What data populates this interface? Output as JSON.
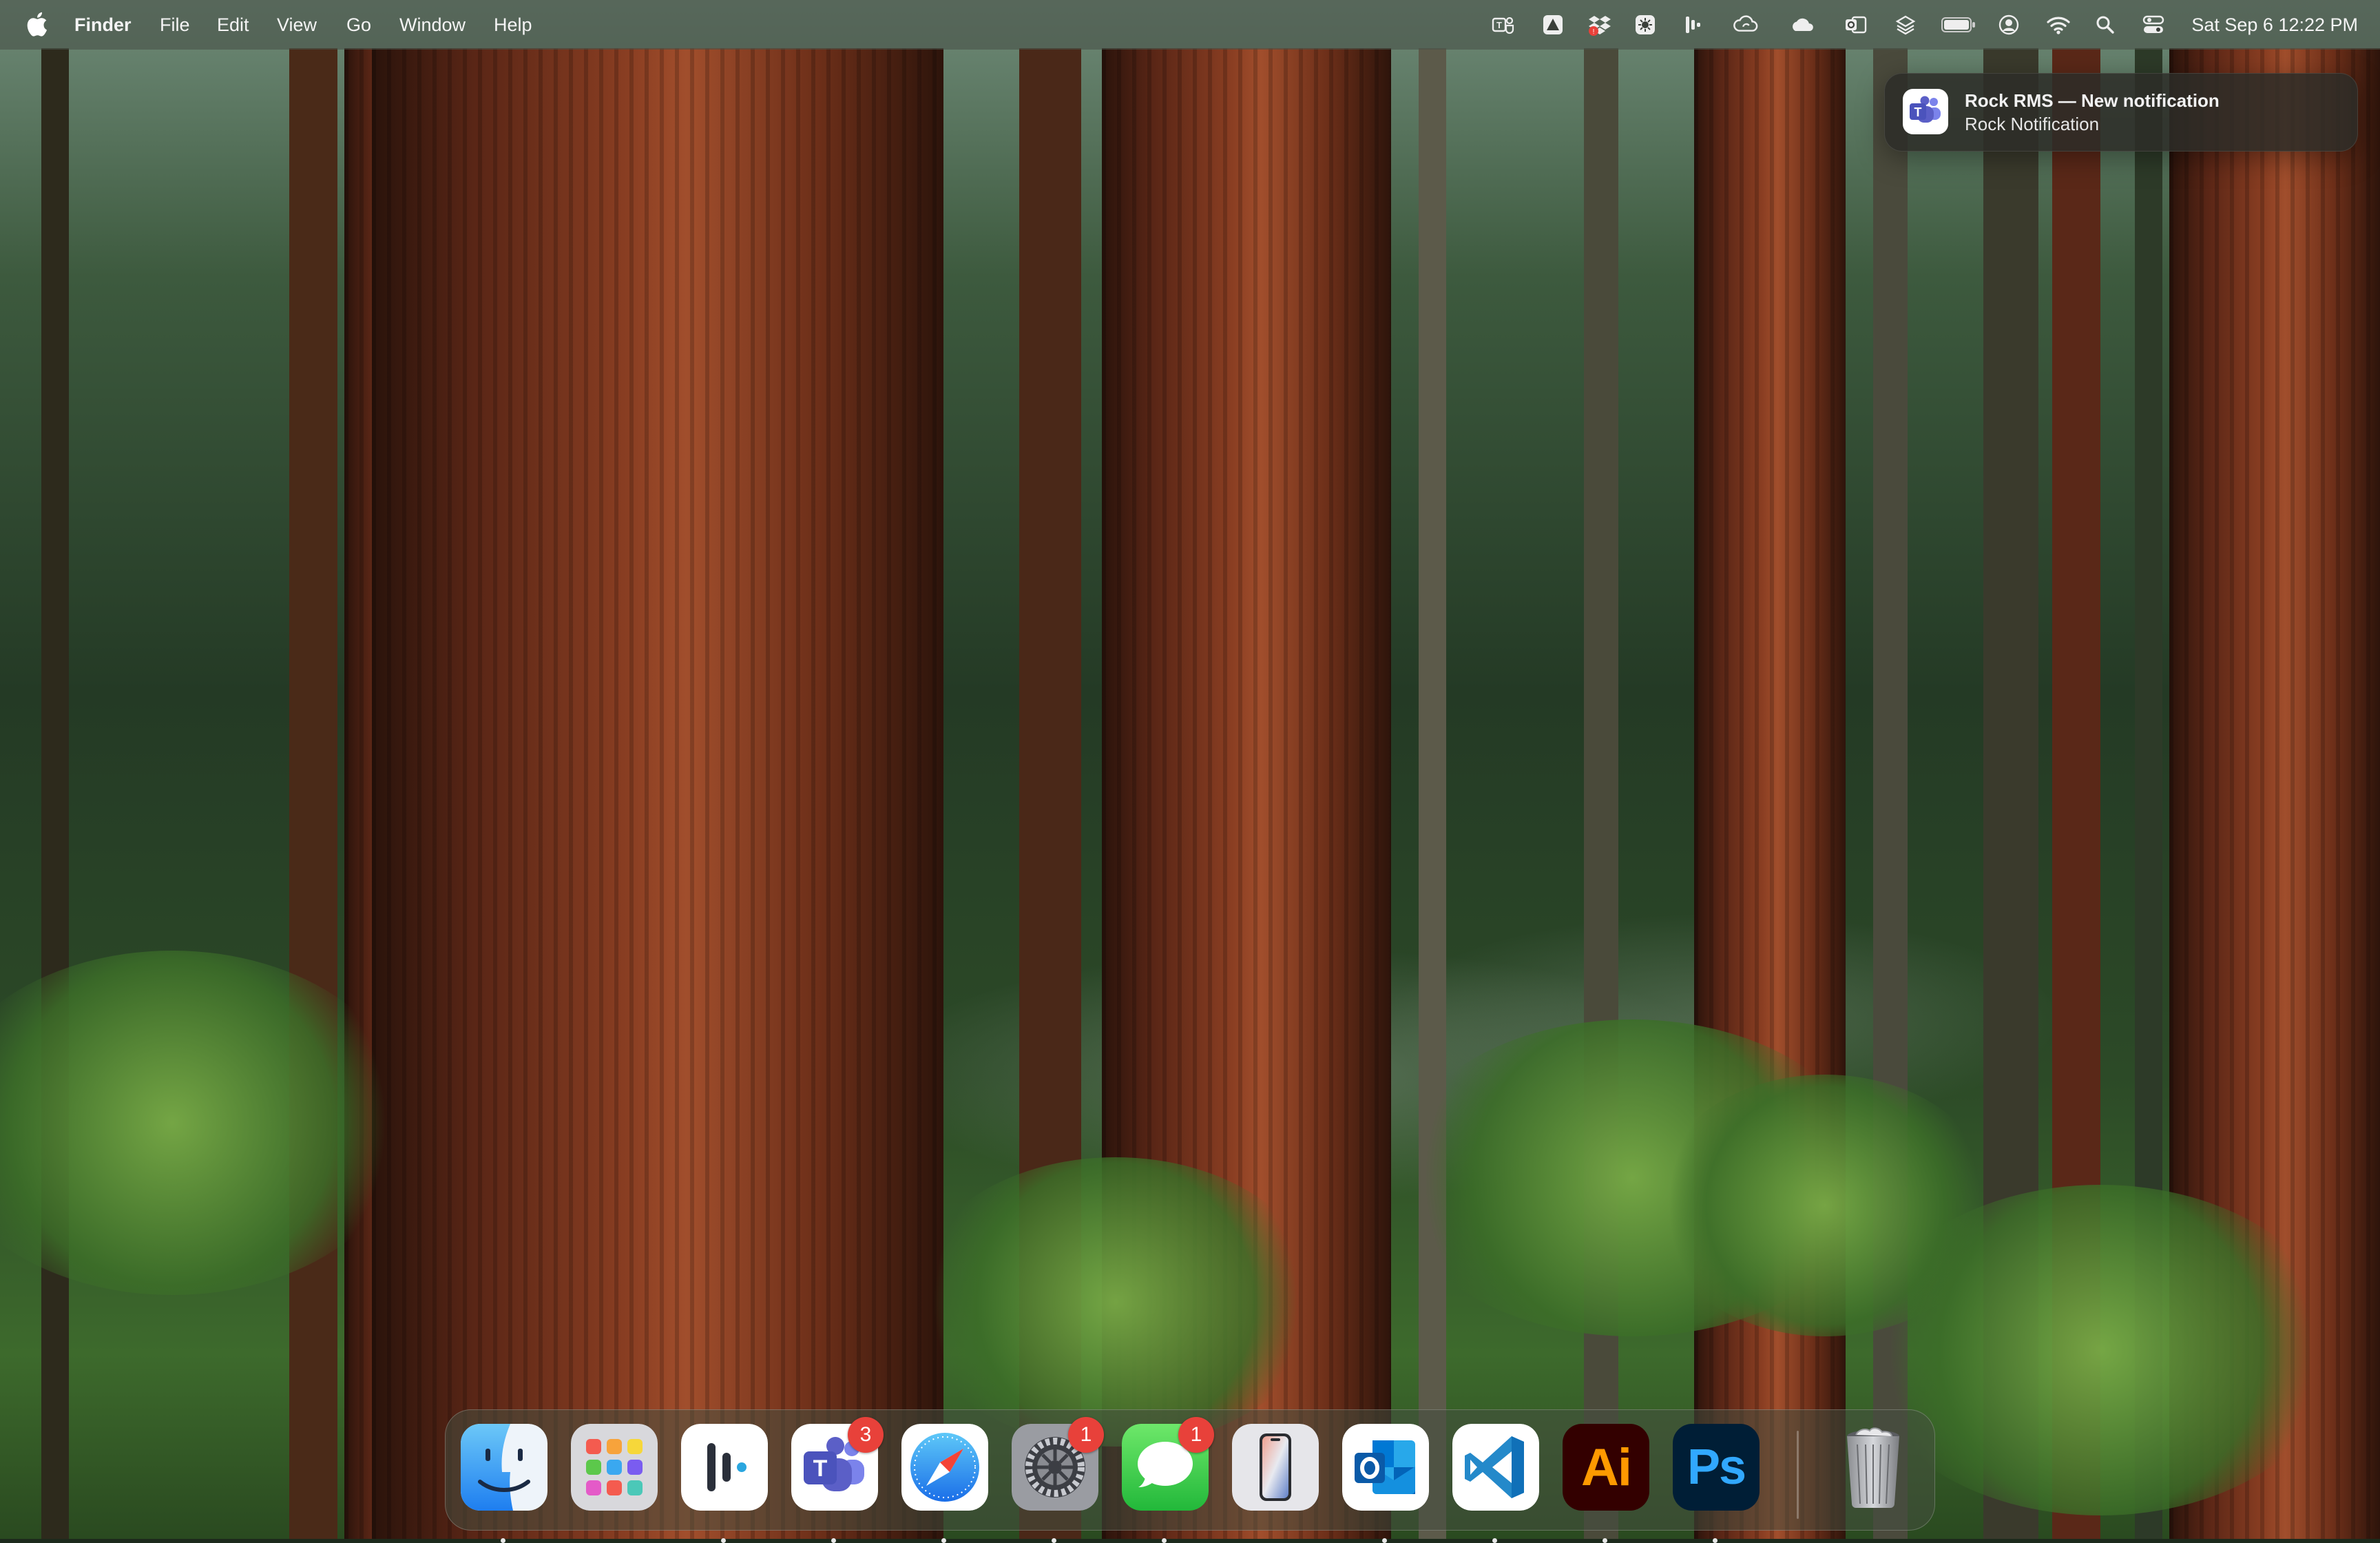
{
  "menubar": {
    "app_name": "Finder",
    "items": [
      {
        "label": "File"
      },
      {
        "label": "Edit"
      },
      {
        "label": "View"
      },
      {
        "label": "Go"
      },
      {
        "label": "Window"
      },
      {
        "label": "Help"
      }
    ],
    "status_icons": [
      "teams-icon",
      "tip-icon",
      "dropbox-icon",
      "sun-icon",
      "bars-icon",
      "cloud-sync-icon",
      "onedrive-icon",
      "outlook-icon",
      "layers-icon",
      "battery-icon",
      "user-icon",
      "wifi-icon",
      "search-icon",
      "control-center-icon"
    ],
    "clock": "Sat Sep 6  12:22 PM"
  },
  "notification": {
    "app_icon": "teams-icon",
    "title": "Rock RMS — New notification",
    "body": "Rock Notification"
  },
  "dock": {
    "apps": [
      {
        "name": "Finder",
        "icon": "finder-icon",
        "running": true
      },
      {
        "name": "Launchpad",
        "icon": "launchpad-icon",
        "running": false
      },
      {
        "name": "Linear",
        "icon": "linear-icon",
        "running": true
      },
      {
        "name": "Microsoft Teams",
        "icon": "teams-icon",
        "running": true,
        "badge": "3"
      },
      {
        "name": "Safari",
        "icon": "safari-icon",
        "running": true
      },
      {
        "name": "System Settings",
        "icon": "settings-icon",
        "running": true,
        "badge": "1"
      },
      {
        "name": "Messages",
        "icon": "messages-icon",
        "running": true,
        "badge": "1"
      },
      {
        "name": "iPhone Mirroring",
        "icon": "iphone-icon",
        "running": false
      },
      {
        "name": "Microsoft Outlook",
        "icon": "outlook-icon",
        "running": true
      },
      {
        "name": "Visual Studio Code",
        "icon": "vscode-icon",
        "running": true
      },
      {
        "name": "Adobe Illustrator",
        "icon": "illustrator-icon",
        "running": true,
        "label": "Ai"
      },
      {
        "name": "Adobe Photoshop",
        "icon": "photoshop-icon",
        "running": true,
        "label": "Ps"
      },
      {
        "name": "Trash",
        "icon": "trash-icon",
        "running": false
      }
    ]
  },
  "colors": {
    "badge": "#e8413a",
    "teams": "#5b5fc7",
    "messages": "#35c94a",
    "illustrator_bg": "#330000",
    "illustrator_fg": "#ff9a00",
    "photoshop_bg": "#001e36",
    "photoshop_fg": "#31a8ff",
    "vscode": "#2489ca"
  }
}
